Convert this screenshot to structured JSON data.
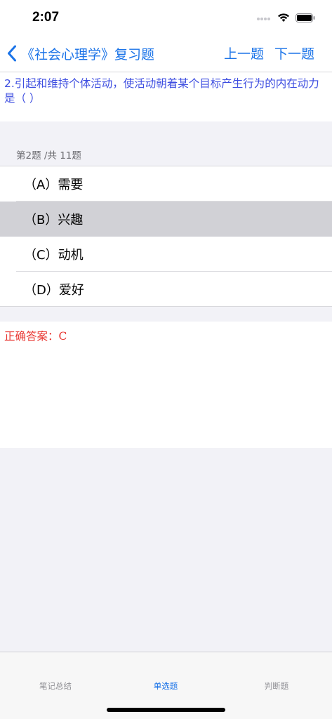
{
  "status_bar": {
    "time": "2:07",
    "icons": [
      "signal-icon",
      "wifi-icon",
      "battery-icon"
    ]
  },
  "nav": {
    "back_title": "《社会心理学》复习题",
    "prev_label": "上一题",
    "next_label": "下一题"
  },
  "question": {
    "text": "2.引起和维持个体活动，使活动朝着某个目标产生行为的内在动力是（  ）",
    "counter": "第2题 /共 11题"
  },
  "options": [
    {
      "label": "（A）需要",
      "selected": false
    },
    {
      "label": "（B）兴趣",
      "selected": true
    },
    {
      "label": "（C）动机",
      "selected": false
    },
    {
      "label": "（D）爱好",
      "selected": false
    }
  ],
  "answer": {
    "text": "正确答案：C"
  },
  "tabs": [
    {
      "label": "笔记总结",
      "active": false
    },
    {
      "label": "单选题",
      "active": true
    },
    {
      "label": "判断题",
      "active": false
    }
  ],
  "colors": {
    "accent": "#1a73e8",
    "question_text": "#3d4de0",
    "answer_text": "#e8342f",
    "selected_row": "#d1d1d6"
  }
}
